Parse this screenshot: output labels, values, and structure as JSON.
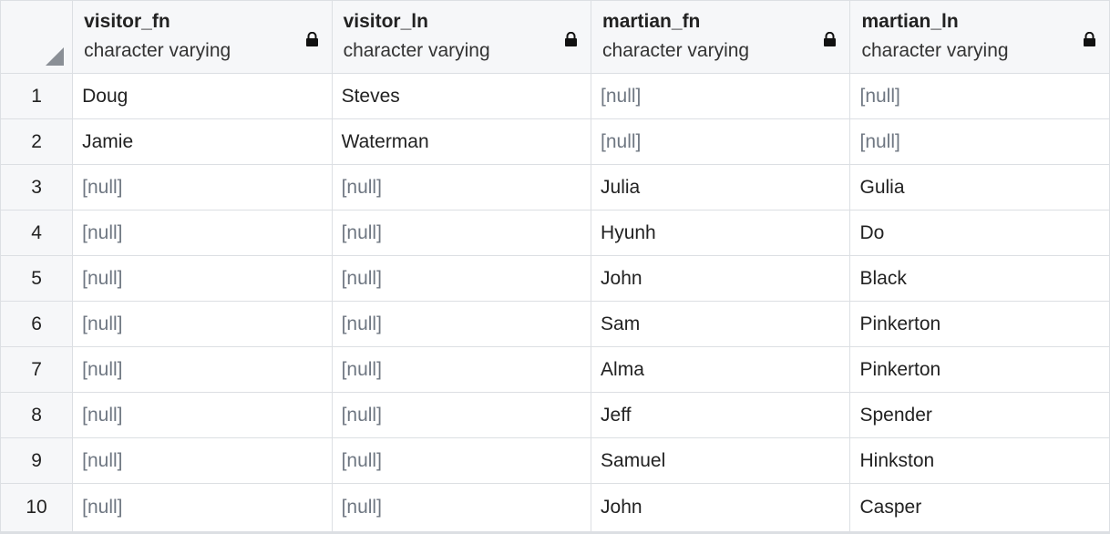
{
  "columns": [
    {
      "name": "visitor_fn",
      "type": "character varying",
      "locked": true
    },
    {
      "name": "visitor_ln",
      "type": "character varying",
      "locked": true
    },
    {
      "name": "martian_fn",
      "type": "character varying",
      "locked": true
    },
    {
      "name": "martian_ln",
      "type": "character varying",
      "locked": true
    }
  ],
  "null_text": "[null]",
  "rows": [
    {
      "num": "1",
      "cells": [
        "Doug",
        "Steves",
        null,
        null
      ]
    },
    {
      "num": "2",
      "cells": [
        "Jamie",
        "Waterman",
        null,
        null
      ]
    },
    {
      "num": "3",
      "cells": [
        null,
        null,
        "Julia",
        "Gulia"
      ]
    },
    {
      "num": "4",
      "cells": [
        null,
        null,
        "Hyunh",
        "Do"
      ]
    },
    {
      "num": "5",
      "cells": [
        null,
        null,
        "John",
        "Black"
      ]
    },
    {
      "num": "6",
      "cells": [
        null,
        null,
        "Sam",
        "Pinkerton"
      ]
    },
    {
      "num": "7",
      "cells": [
        null,
        null,
        "Alma",
        "Pinkerton"
      ]
    },
    {
      "num": "8",
      "cells": [
        null,
        null,
        "Jeff",
        "Spender"
      ]
    },
    {
      "num": "9",
      "cells": [
        null,
        null,
        "Samuel",
        "Hinkston"
      ]
    },
    {
      "num": "10",
      "cells": [
        null,
        null,
        "John",
        "Casper"
      ]
    }
  ],
  "colors": {
    "header_bg": "#f6f7f9",
    "grid_line": "#dcdfe3",
    "null_text": "#6f7782"
  }
}
